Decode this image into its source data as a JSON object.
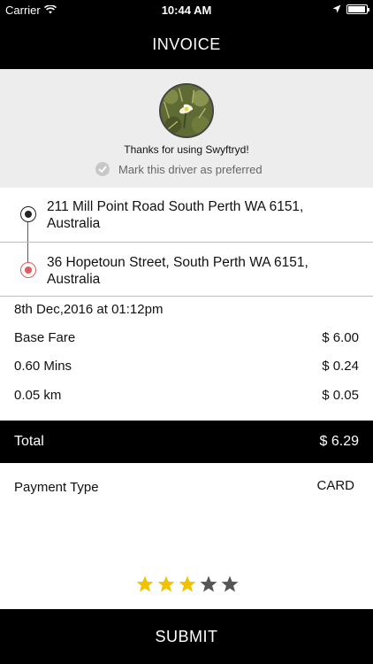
{
  "status_bar": {
    "carrier": "Carrier",
    "time": "10:44 AM"
  },
  "nav": {
    "title": "INVOICE"
  },
  "driver": {
    "thanks_text": "Thanks for using Swyftryd!",
    "preferred_label": "Mark this driver as preferred"
  },
  "route": {
    "from": "211 Mill Point Road South Perth WA 6151, Australia",
    "to": "36 Hopetoun Street, South Perth WA 6151, Australia"
  },
  "fare": {
    "date": "8th Dec,2016 at 01:12pm",
    "items": [
      {
        "label": "Base Fare",
        "value": "$ 6.00"
      },
      {
        "label": "0.60 Mins",
        "value": "$ 0.24"
      },
      {
        "label": "0.05 km",
        "value": "$ 0.05"
      }
    ],
    "total_label": "Total",
    "total_value": "$ 6.29"
  },
  "payment": {
    "label": "Payment Type",
    "value": "CARD"
  },
  "rating": {
    "value": 3,
    "max": 5,
    "filled_color": "#f2c200",
    "empty_color": "#555555"
  },
  "submit_label": "SUBMIT"
}
